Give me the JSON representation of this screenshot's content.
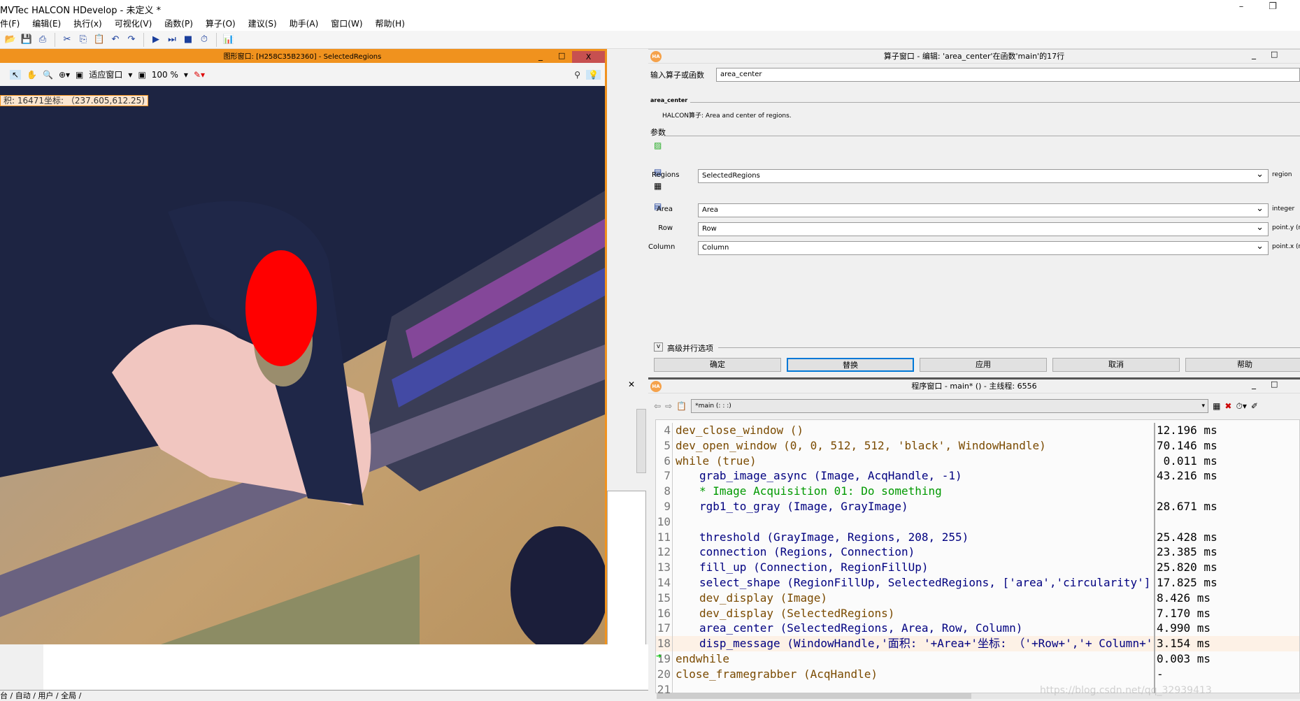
{
  "app": {
    "title": "MVTec HALCON HDevelop - 未定义 *",
    "minimize": "–",
    "restore": "❐"
  },
  "menu": [
    "件(F)",
    "编辑(E)",
    "执行(x)",
    "可视化(V)",
    "函数(P)",
    "算子(O)",
    "建议(S)",
    "助手(A)",
    "窗口(W)",
    "帮助(H)"
  ],
  "toolbar_icons": [
    "open-icon",
    "save-icon",
    "print-icon",
    "cut-icon",
    "copy-icon",
    "paste-icon",
    "undo-icon",
    "redo-icon",
    "run-icon",
    "step-icon",
    "stop-icon",
    "profiler-icon",
    "histogram-icon"
  ],
  "graphics": {
    "title": "图形窗口: [H258C35B2360] - SelectedRegions",
    "fit_label": "适应窗口",
    "zoom": "100 %",
    "readout": "积: 16471坐标: （237.605,612.25)",
    "close": "X",
    "region_color": "#ff0000"
  },
  "operator": {
    "title": "算子窗口 - 编辑: 'area_center'在函数'main'的17行",
    "input_label": "输入算子或函数",
    "input_value": "area_center",
    "op_name": "area_center",
    "description": "HALCON算子: Area and center of regions.",
    "params_heading": "参数",
    "params": [
      {
        "label": "Regions",
        "value": "SelectedRegions",
        "type": "region"
      },
      {
        "label": "Area",
        "value": "Area",
        "type": "integer"
      },
      {
        "label": "Row",
        "value": "Row",
        "type": "point.y (re"
      },
      {
        "label": "Column",
        "value": "Column",
        "type": "point.x (re"
      }
    ],
    "advanced": "高级并行选项",
    "buttons": [
      "确定",
      "替换",
      "应用",
      "取消",
      "帮助"
    ]
  },
  "program": {
    "title": "程序窗口 - main* () - 主线程: 6556",
    "procedure": "*main (: : :)",
    "lines": [
      {
        "n": "4",
        "code": "dev_close_window ()",
        "time": "12.196 ms",
        "kind": "dev",
        "indent": 0
      },
      {
        "n": "5",
        "code": "dev_open_window (0, 0, 512, 512, 'black', WindowHandle)",
        "time": "70.146 ms",
        "kind": "dev",
        "indent": 0
      },
      {
        "n": "6",
        "code": "while (true)",
        "time": " 0.011 ms",
        "kind": "ctrl",
        "indent": 0
      },
      {
        "n": "7",
        "code": "grab_image_async (Image, AcqHandle, -1)",
        "time": "43.216 ms",
        "kind": "op",
        "indent": 1
      },
      {
        "n": "8",
        "code": "* Image Acquisition 01: Do something",
        "time": "",
        "kind": "comment",
        "indent": 1
      },
      {
        "n": "9",
        "code": "rgb1_to_gray (Image, GrayImage)",
        "time": "28.671 ms",
        "kind": "op",
        "indent": 1
      },
      {
        "n": "10",
        "code": "",
        "time": "",
        "kind": "op",
        "indent": 0
      },
      {
        "n": "11",
        "code": "threshold (GrayImage, Regions, 208, 255)",
        "time": "25.428 ms",
        "kind": "op",
        "indent": 1
      },
      {
        "n": "12",
        "code": "connection (Regions, Connection)",
        "time": "23.385 ms",
        "kind": "op",
        "indent": 1
      },
      {
        "n": "13",
        "code": "fill_up (Connection, RegionFillUp)",
        "time": "25.820 ms",
        "kind": "op",
        "indent": 1
      },
      {
        "n": "14",
        "code": "select_shape (RegionFillUp, SelectedRegions, ['area','circularity'], 'and',",
        "time": "17.825 ms",
        "kind": "op",
        "indent": 1
      },
      {
        "n": "15",
        "code": "dev_display (Image)",
        "time": "8.426 ms",
        "kind": "dev",
        "indent": 1
      },
      {
        "n": "16",
        "code": "dev_display (SelectedRegions)",
        "time": "7.170 ms",
        "kind": "dev",
        "indent": 1
      },
      {
        "n": "17",
        "code": "area_center (SelectedRegions, Area, Row, Column)",
        "time": "4.990 ms",
        "kind": "op",
        "indent": 1
      },
      {
        "n": "18",
        "code": "disp_message (WindowHandle,'面积: '+Area+'坐标: （'+Row+','+ Column+')', 'wi",
        "time": "3.154 ms",
        "kind": "op",
        "indent": 1
      },
      {
        "n": "19",
        "code": "endwhile",
        "time": "0.003 ms",
        "kind": "ctrl",
        "indent": 0
      },
      {
        "n": "20",
        "code": "close_framegrabber (AcqHandle)",
        "time": "-",
        "kind": "dev",
        "indent": 0
      },
      {
        "n": "21",
        "code": "",
        "time": "",
        "kind": "op",
        "indent": 0
      }
    ],
    "watermark": "https://blog.csdn.net/qq_32939413"
  },
  "bottom_tabs": "台 / 自动 / 用户 / 全局 /",
  "colors": {
    "accent": "#f0921e",
    "op": "#000080",
    "dev": "#7a4a00",
    "comment": "#009900",
    "highlight_line": "#fdf1e6"
  }
}
